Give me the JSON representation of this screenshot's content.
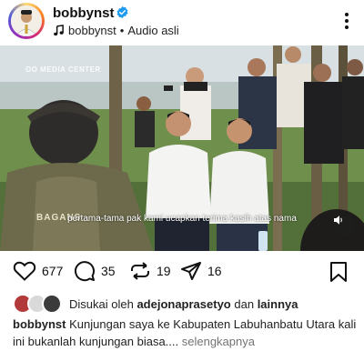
{
  "header": {
    "username": "bobbynst",
    "verified_icon": "verified-badge-icon",
    "audio_user": "bobbynst",
    "audio_separator": " • ",
    "audio_label": "Audio asli",
    "more_icon": "more-vertical-icon"
  },
  "media": {
    "watermark": "OO MEDIA CENTER",
    "subtitle": "pertama-tama pak kami ucapkan terima kasih atas nama",
    "vest_text": "BAGANS",
    "sound_icon": "speaker-icon"
  },
  "actions": {
    "like_count": "677",
    "comment_count": "35",
    "repost_count": "19",
    "share_count": "16"
  },
  "likes": {
    "prefix": "Disukai oleh ",
    "user": "adejonaprasetyo",
    "connector": " dan ",
    "others": "lainnya"
  },
  "caption": {
    "user": "bobbynst",
    "text": " Kunjungan saya ke Kabupaten Labuhanbatu Utara kali ini bukanlah kunjungan biasa....",
    "more": " selengkapnya"
  },
  "colors": {
    "verified": "#1d9bf0",
    "text": "#111111",
    "muted": "#737373"
  }
}
